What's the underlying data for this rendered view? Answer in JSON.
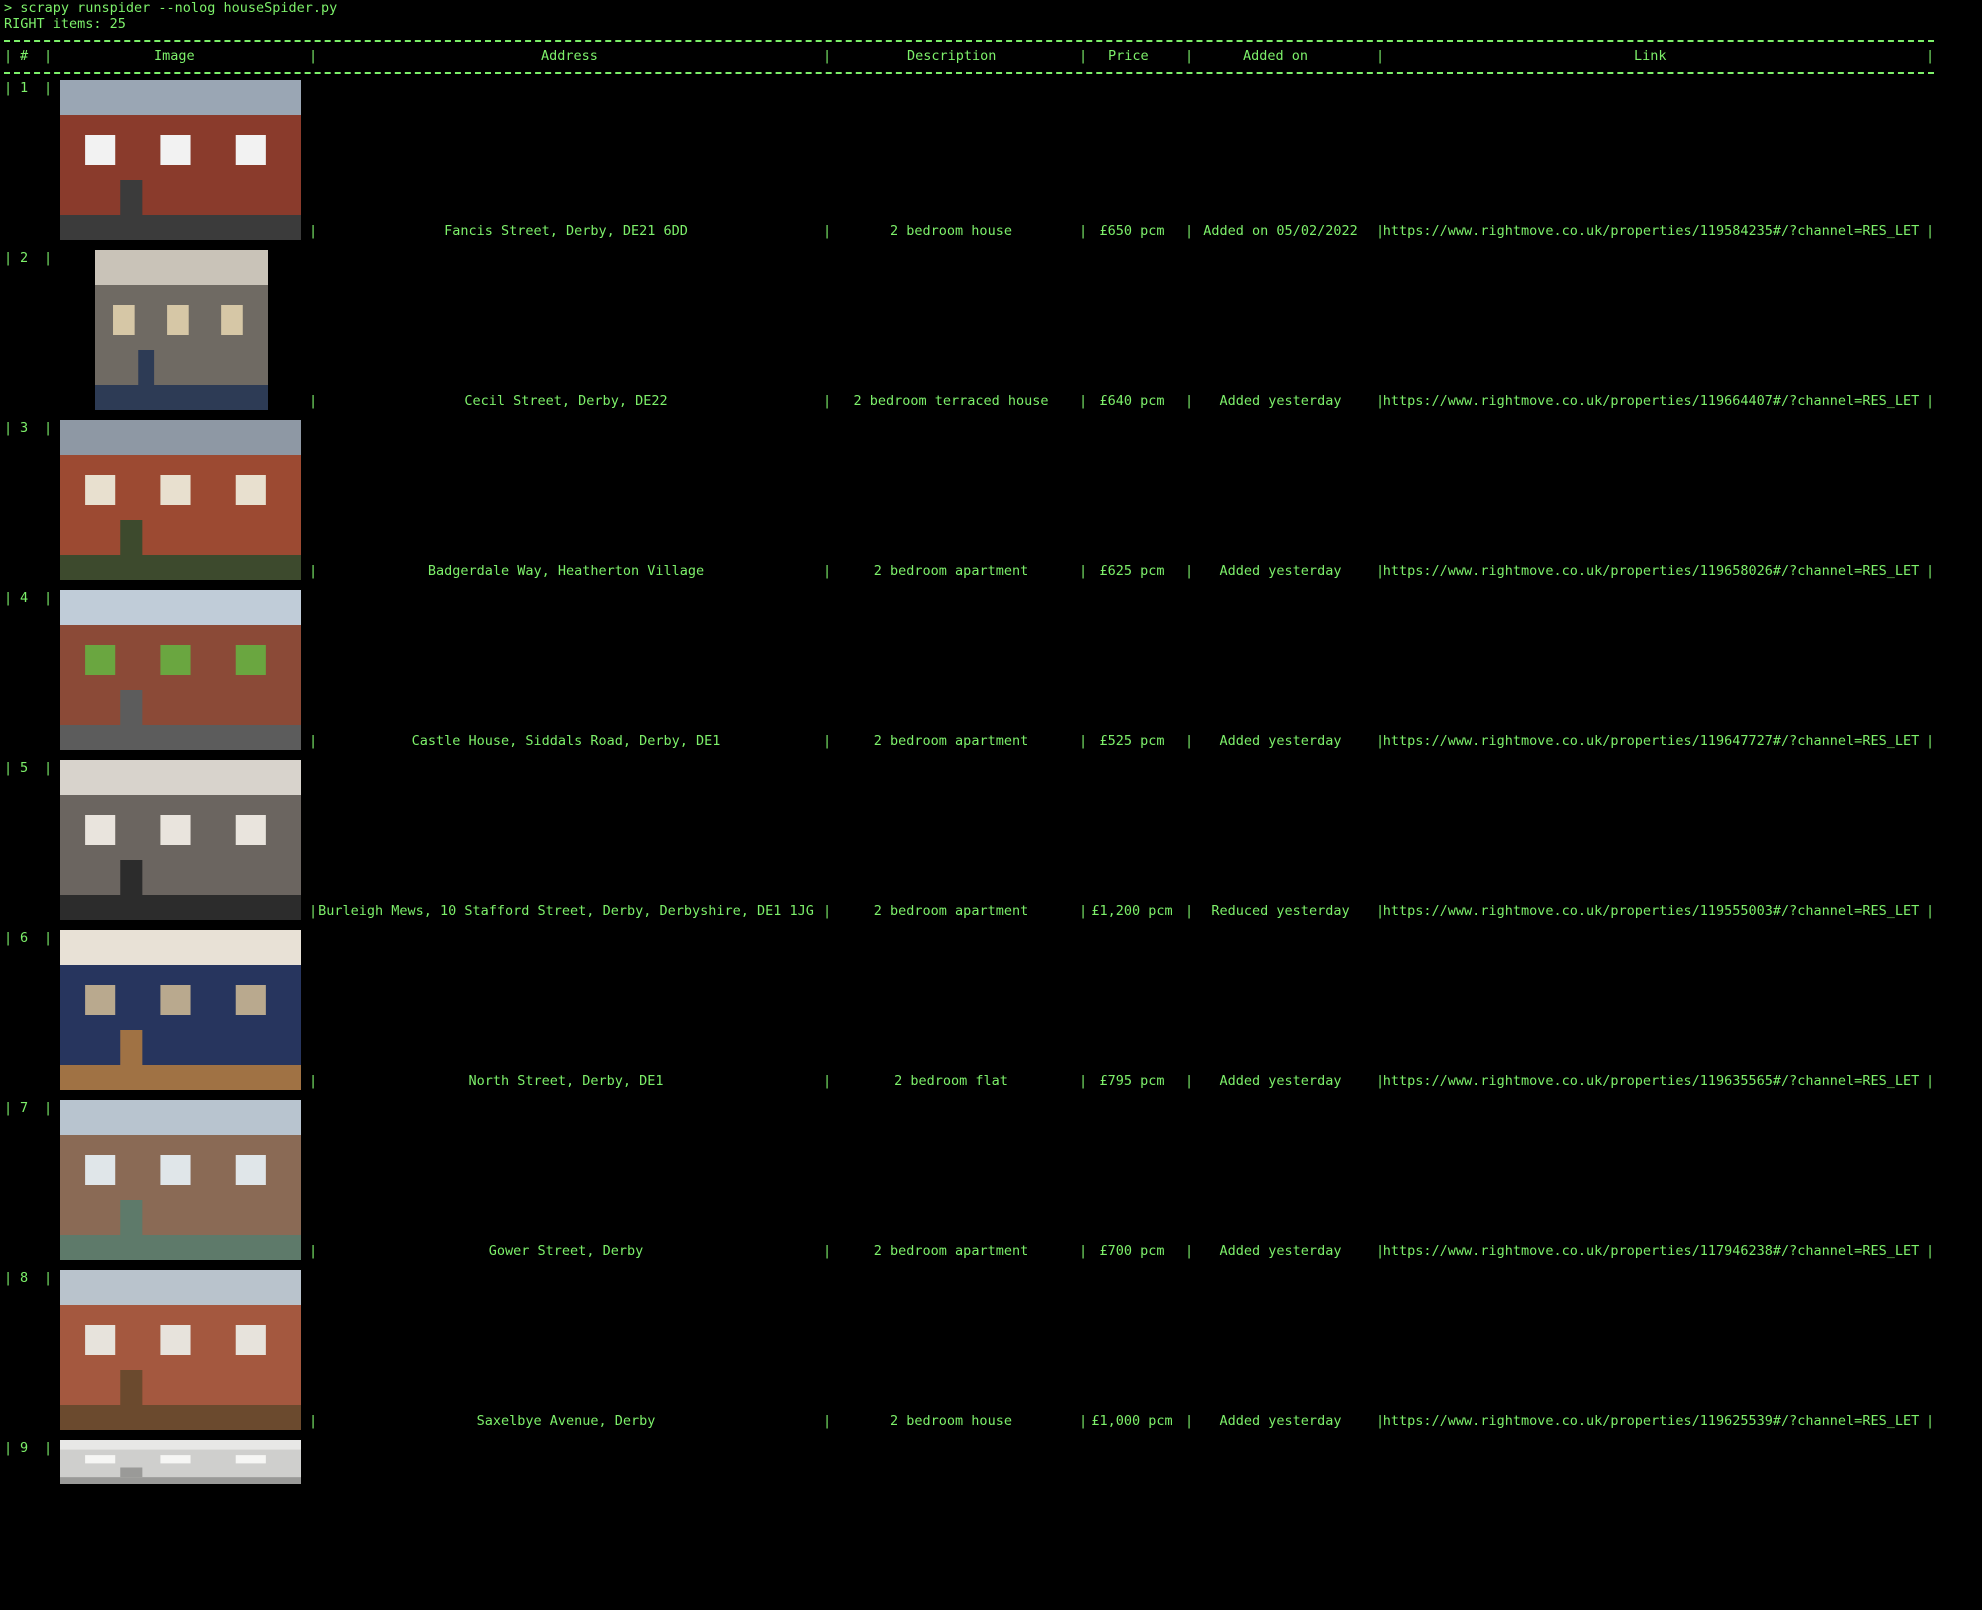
{
  "terminal": {
    "command": "> scrapy runspider --nolog houseSpider.py",
    "info": "RIGHT items: 25"
  },
  "table": {
    "headers": {
      "num": "#",
      "image": "Image",
      "address": "Address",
      "description": "Description",
      "price": "Price",
      "added": "Added on",
      "link": "Link"
    },
    "rows": [
      {
        "num": "1",
        "address": "Fancis Street, Derby, DE21 6DD",
        "description": "2 bedroom house",
        "price": "£650 pcm",
        "added": "Added on 05/02/2022",
        "link": "https://www.rightmove.co.uk/properties/119584235#/?channel=RES_LET",
        "image": "red-brick-terraced-house-photo"
      },
      {
        "num": "2",
        "address": "Cecil Street, Derby, DE22",
        "description": "2 bedroom terraced house",
        "price": "£640 pcm",
        "added": "Added yesterday",
        "link": "https://www.rightmove.co.uk/properties/119664407#/?channel=RES_LET",
        "image": "kitchen-dining-room-photo"
      },
      {
        "num": "3",
        "address": "Badgerdale Way, Heatherton Village",
        "description": "2 bedroom apartment",
        "price": "£625 pcm",
        "added": "Added yesterday",
        "link": "https://www.rightmove.co.uk/properties/119658026#/?channel=RES_LET",
        "image": "apartment-block-photo"
      },
      {
        "num": "4",
        "address": "Castle House, Siddals Road, Derby, DE1",
        "description": "2 bedroom apartment",
        "price": "£525 pcm",
        "added": "Added yesterday",
        "link": "https://www.rightmove.co.uk/properties/119647727#/?channel=RES_LET",
        "image": "apartments-with-lawn-photo"
      },
      {
        "num": "5",
        "address": "Burleigh Mews, 10 Stafford Street, Derby, Derbyshire, DE1 1JG",
        "description": "2 bedroom apartment",
        "price": "£1,200 pcm",
        "added": "Reduced yesterday",
        "link": "https://www.rightmove.co.uk/properties/119555003#/?channel=RES_LET",
        "image": "living-room-photo"
      },
      {
        "num": "6",
        "address": "North Street, Derby, DE1",
        "description": "2 bedroom flat",
        "price": "£795 pcm",
        "added": "Added yesterday",
        "link": "https://www.rightmove.co.uk/properties/119635565#/?channel=RES_LET",
        "image": "bedroom-photo"
      },
      {
        "num": "7",
        "address": "Gower Street, Derby",
        "description": "2 bedroom apartment",
        "price": "£700 pcm",
        "added": "Added yesterday",
        "link": "https://www.rightmove.co.uk/properties/117946238#/?channel=RES_LET",
        "image": "modern-apartment-block-photo"
      },
      {
        "num": "8",
        "address": "Saxelbye Avenue, Derby",
        "description": "2 bedroom house",
        "price": "£1,000 pcm",
        "added": "Added yesterday",
        "link": "https://www.rightmove.co.uk/properties/119625539#/?channel=RES_LET",
        "image": "detached-brick-house-photo"
      },
      {
        "num": "9",
        "address": "",
        "description": "",
        "price": "",
        "added": "",
        "link": "",
        "image": "interior-photo"
      }
    ]
  },
  "colors": {
    "text": "#7df06a",
    "background": "#000000"
  }
}
